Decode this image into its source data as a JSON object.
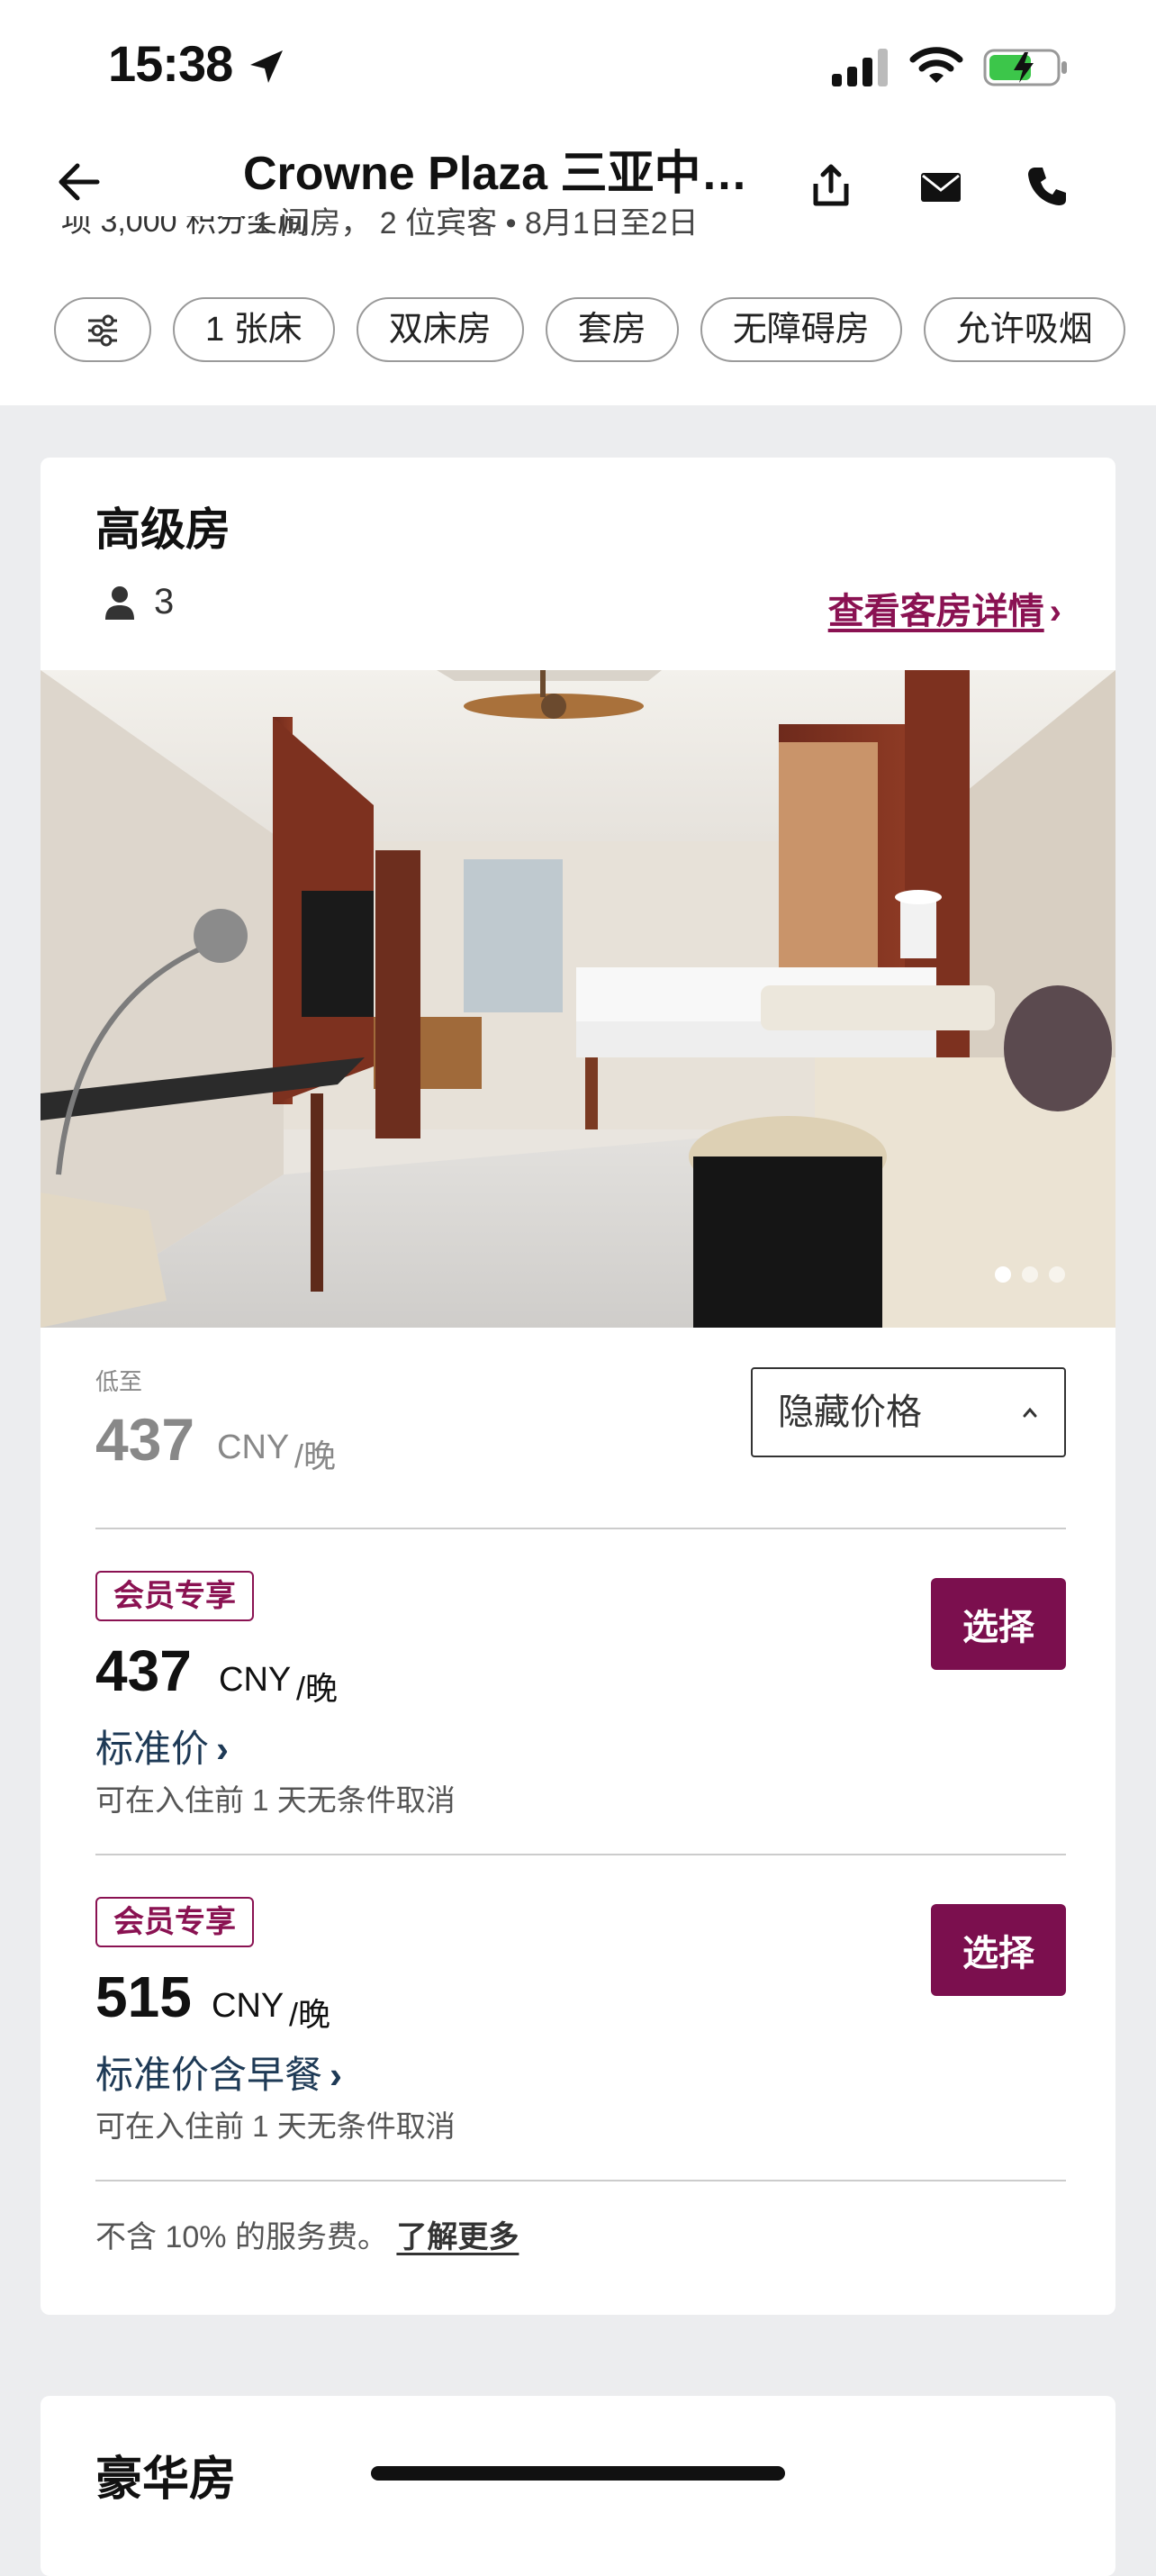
{
  "status_bar": {
    "time": "15:38"
  },
  "header": {
    "title": "Crowne Plaza 三亚中…",
    "subtitle": "1 间房， 2 位宾客 • 8月1日至2日",
    "clipped_line": "项 3,000 积分奖励"
  },
  "filters": [
    "1 张床",
    "双床房",
    "套房",
    "无障碍房",
    "允许吸烟"
  ],
  "room": {
    "name": "高级房",
    "guests": "3",
    "detail_link": "查看客房详情",
    "from_label": "低至",
    "from_price": "437",
    "currency": "CNY",
    "per_night": "/晚",
    "hide_price": "隐藏价格",
    "rates": [
      {
        "badge": "会员专享",
        "price": "437",
        "currency": "CNY",
        "per_night": "/晚",
        "name": "标准价",
        "cancel": "可在入住前 1 天无条件取消",
        "button": "选择"
      },
      {
        "badge": "会员专享",
        "price": "515",
        "currency": "CNY",
        "per_night": "/晚",
        "name": "标准价含早餐",
        "cancel": "可在入住前 1 天无条件取消",
        "button": "选择"
      }
    ],
    "fee_note": "不含 10% 的服务费。",
    "fee_link": "了解更多"
  },
  "next_room": {
    "name": "豪华房"
  },
  "colors": {
    "brand": "#7b0f4e",
    "link": "#8a1252",
    "rate_name": "#1e3a56"
  }
}
